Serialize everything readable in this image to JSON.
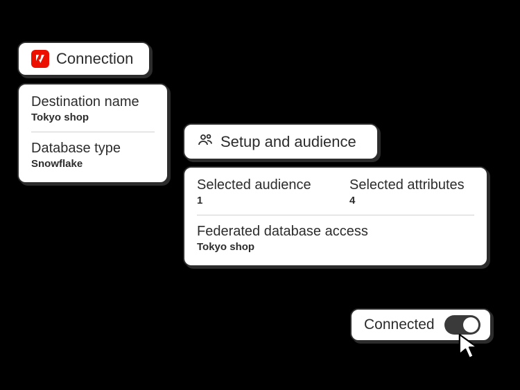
{
  "connection": {
    "header_label": "Connection",
    "destination_label": "Destination name",
    "destination_value": "Tokyo shop",
    "dbtype_label": "Database type",
    "dbtype_value": "Snowflake"
  },
  "setup": {
    "header_label": "Setup and audience",
    "selected_audience_label": "Selected audience",
    "selected_audience_value": "1",
    "selected_attributes_label": "Selected attributes",
    "selected_attributes_value": "4",
    "federated_label": "Federated database access",
    "federated_value": "Tokyo shop"
  },
  "status": {
    "connected_label": "Connected",
    "toggle_on": true
  },
  "colors": {
    "adobe_red": "#eb1000",
    "ink": "#2c2c2c"
  }
}
